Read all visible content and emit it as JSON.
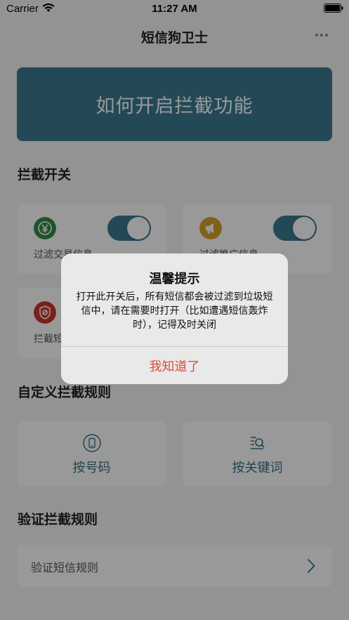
{
  "status_bar": {
    "carrier": "Carrier",
    "time": "11:27 AM"
  },
  "nav": {
    "title": "短信狗卫士",
    "more_icon": "more-dots-icon"
  },
  "banner": {
    "label": "如何开启拦截功能"
  },
  "sections": {
    "intercept_switch": "拦截开关",
    "custom_rules": "自定义拦截规则",
    "verify_rules": "验证拦截规则"
  },
  "switch_cards": [
    {
      "label": "过滤交易信息",
      "icon": "yen-icon",
      "color": "#2f8a4a",
      "on": true
    },
    {
      "label": "过滤推广信息",
      "icon": "megaphone-icon",
      "color": "#d8a12a",
      "on": true
    },
    {
      "label": "拦截短信",
      "icon": "shield-icon",
      "color": "#c9362b"
    }
  ],
  "rule_cards": [
    {
      "label": "按号码",
      "icon": "phone-icon"
    },
    {
      "label": "按关键词",
      "icon": "keyword-search-icon"
    }
  ],
  "verify": {
    "label": "验证短信规则"
  },
  "alert": {
    "title": "温馨提示",
    "message": "打开此开关后，所有短信都会被过滤到垃圾短信中，请在需要时打开（比如遭遇短信轰炸时），记得及时关闭",
    "button": "我知道了"
  },
  "colors": {
    "accent": "#3b7a91",
    "alert_button": "#e24a3a"
  }
}
